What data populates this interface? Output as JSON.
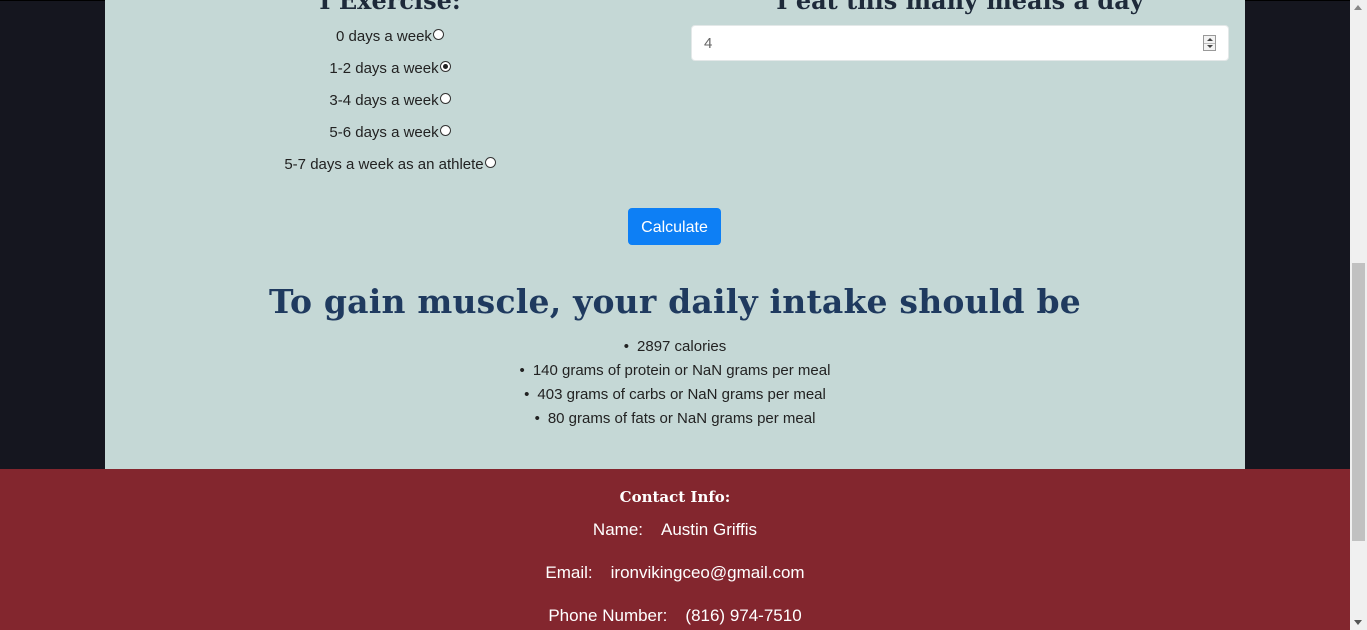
{
  "exercise": {
    "heading": "I Exercise:",
    "options": [
      {
        "label": "0 days a week",
        "checked": false
      },
      {
        "label": "1-2 days a week",
        "checked": true
      },
      {
        "label": "3-4 days a week",
        "checked": false
      },
      {
        "label": "5-6 days a week",
        "checked": false
      },
      {
        "label": "5-7 days a week as an athlete",
        "checked": false
      }
    ]
  },
  "meals": {
    "heading": "I eat this many meals a day",
    "value": "4"
  },
  "calculate_label": "Calculate",
  "result": {
    "title": "To gain muscle, your daily intake should be",
    "items": [
      "2897 calories",
      "140 grams of protein or NaN grams per meal",
      "403 grams of carbs or NaN grams per meal",
      "80 grams of fats or NaN grams per meal"
    ]
  },
  "contact": {
    "title": "Contact Info:",
    "name_label": "Name:",
    "name_value": "Austin Griffis",
    "email_label": "Email:",
    "email_value": "ironvikingceo@gmail.com",
    "phone_label": "Phone Number:",
    "phone_value": "(816) 974-7510"
  },
  "colors": {
    "panel_bg": "#c5d8d6",
    "footer_bg": "#83262e",
    "button_bg": "#0d7ff5",
    "title_color": "#1f3a5f",
    "page_bg": "#15161f"
  },
  "icons": [
    "radio-unchecked",
    "radio-checked",
    "number-spinner",
    "scroll-arrow-up",
    "scroll-arrow-down"
  ]
}
